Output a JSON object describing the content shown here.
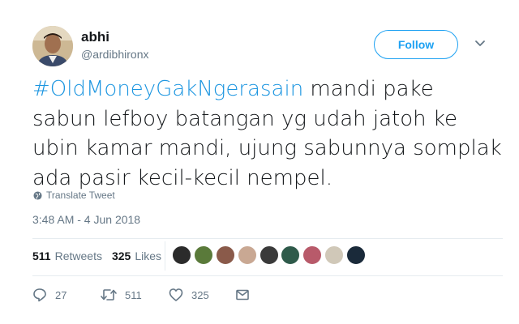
{
  "user": {
    "name": "abhi",
    "handle": "@ardibhironx"
  },
  "follow_label": "Follow",
  "tweet": {
    "hashtag": "#OldMoneyGakNgerasain",
    "text": " mandi pake sabun lefboy batangan yg udah jatoh ke ubin kamar mandi, ujung sabunnya somplak ada pasir kecil-kecil nempel."
  },
  "translate_label": "Translate Tweet",
  "timestamp": "3:48 AM - 4 Jun 2018",
  "stats": {
    "retweets_count": "511",
    "retweets_label": "Retweets",
    "likes_count": "325",
    "likes_label": "Likes"
  },
  "likers": [
    "#2b2b2b",
    "#5a7a3a",
    "#8a5a4a",
    "#c9a893",
    "#3a3a3a",
    "#2e5a4a",
    "#b85a6a",
    "#d0c8b8",
    "#1a2a3a"
  ],
  "actions": {
    "reply_count": "27",
    "retweet_count": "511",
    "like_count": "325"
  },
  "colors": {
    "accent": "#1da1f2",
    "hashtag": "#1b95e0",
    "muted": "#657786"
  }
}
